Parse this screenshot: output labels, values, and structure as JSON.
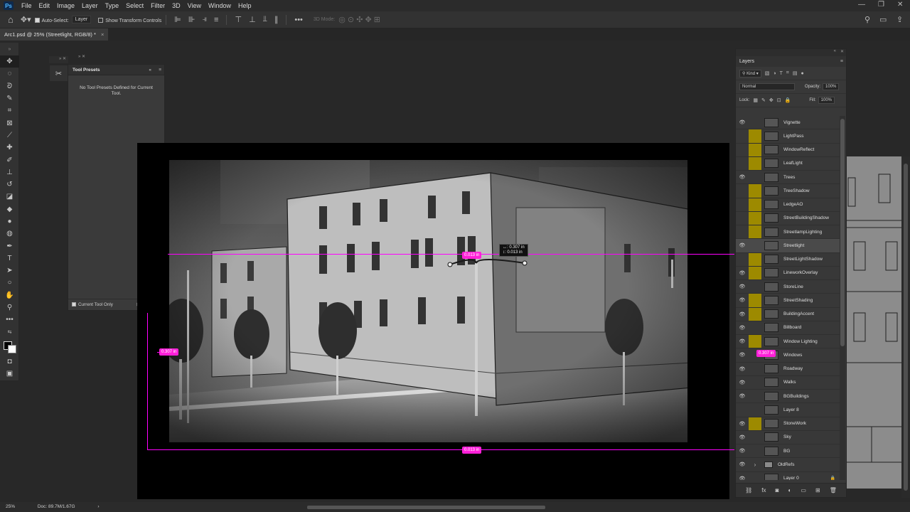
{
  "app": {
    "logo": "Ps"
  },
  "menu": [
    "File",
    "Edit",
    "Image",
    "Layer",
    "Type",
    "Select",
    "Filter",
    "3D",
    "View",
    "Window",
    "Help"
  ],
  "window_controls": {
    "minimize": "—",
    "restore": "❐",
    "close": "✕"
  },
  "options_bar": {
    "auto_select_label": "Auto-Select:",
    "auto_select_checked": true,
    "auto_select_target": "Layer",
    "transform_label": "Show Transform Controls",
    "transform_checked": false,
    "mode_3d_label": "3D Mode:",
    "more": "•••"
  },
  "doc_tab": {
    "title": "Arc1.psd @ 25% (Streetlight, RGB/8) *",
    "close": "×"
  },
  "tool_presets": {
    "title": "Tool Presets",
    "empty_message": "No Tool Presets Defined for Current Tool.",
    "footer_label": "Current Tool Only",
    "footer_checked": true
  },
  "measure": {
    "top_tip_line1": "↔: 0.307 in",
    "top_tip_line2": "↕: 0.013 in",
    "top_label": "0.013 in",
    "left_label": "0.307 in",
    "bottom_label": "0.013 in",
    "layers_label": "0.307 in"
  },
  "layers_panel": {
    "title": "Layers",
    "filter_kind": "Kind",
    "blend_mode": "Normal",
    "opacity_label": "Opacity:",
    "opacity_value": "100%",
    "lock_label": "Lock:",
    "fill_label": "Fill:",
    "fill_value": "100%",
    "selected_layer": "Streetlight",
    "layers": [
      {
        "name": "Vignette",
        "visible": true,
        "color": "none"
      },
      {
        "name": "LightPass",
        "visible": false,
        "color": "yellow"
      },
      {
        "name": "WindowReflect",
        "visible": false,
        "color": "yellow"
      },
      {
        "name": "LeafLight",
        "visible": false,
        "color": "yellow"
      },
      {
        "name": "Trees",
        "visible": true,
        "color": "none"
      },
      {
        "name": "TreeShadow",
        "visible": false,
        "color": "yellow"
      },
      {
        "name": "LedgeAO",
        "visible": false,
        "color": "yellow"
      },
      {
        "name": "StreetBuildingShadow",
        "visible": false,
        "color": "yellow"
      },
      {
        "name": "StreetlampLighting",
        "visible": false,
        "color": "yellow"
      },
      {
        "name": "Streetlight",
        "visible": true,
        "color": "none"
      },
      {
        "name": "StreetLightShadow",
        "visible": false,
        "color": "yellow"
      },
      {
        "name": "LineworkOverlay",
        "visible": true,
        "color": "yellow"
      },
      {
        "name": "StoreLine",
        "visible": true,
        "color": "none"
      },
      {
        "name": "StreetShading",
        "visible": true,
        "color": "yellow"
      },
      {
        "name": "BuildingAccent",
        "visible": true,
        "color": "yellow"
      },
      {
        "name": "Billboard",
        "visible": true,
        "color": "none"
      },
      {
        "name": "Window Lighting",
        "visible": true,
        "color": "yellow"
      },
      {
        "name": "Windows",
        "visible": true,
        "color": "none"
      },
      {
        "name": "Roadway",
        "visible": true,
        "color": "none"
      },
      {
        "name": "Walks",
        "visible": true,
        "color": "none"
      },
      {
        "name": "BGBuildings",
        "visible": true,
        "color": "none"
      },
      {
        "name": "Layer 8",
        "visible": false,
        "color": "none"
      },
      {
        "name": "StoneWork",
        "visible": true,
        "color": "yellow"
      },
      {
        "name": "Sky",
        "visible": true,
        "color": "none"
      },
      {
        "name": "BG",
        "visible": true,
        "color": "none"
      },
      {
        "name": "OldRefs",
        "visible": true,
        "color": "none",
        "group": true
      },
      {
        "name": "Layer 0",
        "visible": true,
        "color": "none",
        "locked": true
      }
    ]
  },
  "status_bar": {
    "zoom": "25%",
    "doc_size": "Doc: 89.7M/1.67G",
    "arrow": "›"
  },
  "colors": {
    "guide": "#ff00ff",
    "label": "#ff20d8",
    "yellow_tag": "#9d8a00"
  }
}
